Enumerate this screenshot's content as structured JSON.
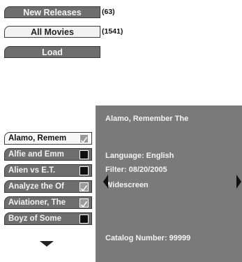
{
  "tabs": {
    "new_releases": {
      "label": "New Releases",
      "count": "(63)"
    },
    "all_movies": {
      "label": "All Movies",
      "count": "(1541)"
    },
    "load": {
      "label": "Load"
    }
  },
  "movie_list": {
    "items": [
      {
        "label": "Alamo, Remem",
        "checked": true,
        "selected": true
      },
      {
        "label": "Alfie and Emm",
        "checked": false,
        "selected": false
      },
      {
        "label": "Alien vs E.T.",
        "checked": false,
        "selected": false
      },
      {
        "label": "Analyze the Of",
        "checked": true,
        "selected": false
      },
      {
        "label": "Aviationer, The",
        "checked": true,
        "selected": false
      },
      {
        "label": "Boyz of Some",
        "checked": false,
        "selected": false
      }
    ],
    "scroll_down_icon": "triangle-down"
  },
  "details": {
    "title": "Alamo, Remember The",
    "language": "Language: English",
    "filter": "Filter: 08/20/2005",
    "format": "Widescreen",
    "catalog": "Catalog Number: 99999",
    "prev_icon": "triangle-left",
    "next_icon": "triangle-right"
  },
  "colors": {
    "dark_button": "#6e6e6e",
    "light_button": "#f2f2f2",
    "panel": "#7a7a7a"
  }
}
